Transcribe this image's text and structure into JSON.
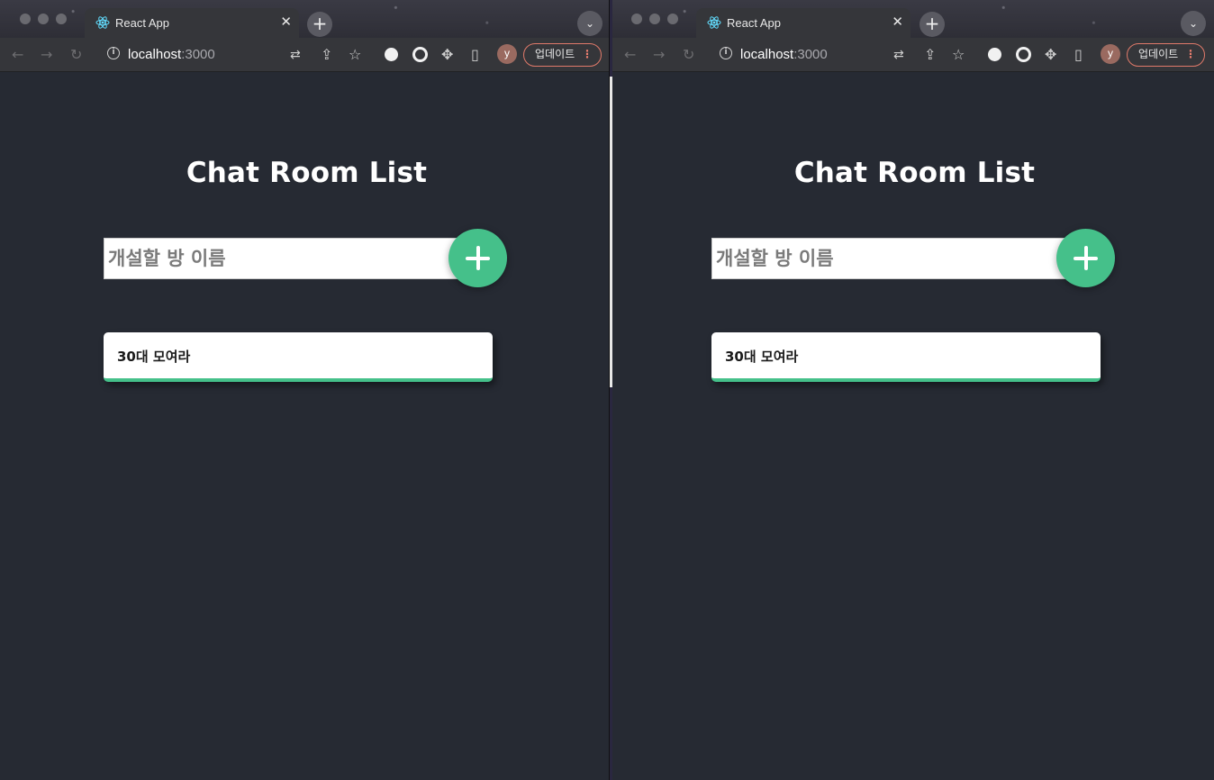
{
  "windows": [
    {
      "tab": {
        "title": "React App",
        "close": "✕"
      },
      "new_tab": "+",
      "url": {
        "host": "localhost",
        "port": ":3000"
      },
      "avatar": "y",
      "update_label": "업데이트",
      "app": {
        "title": "Chat Room List",
        "input_placeholder": "개설할 방 이름",
        "rooms": [
          {
            "name": "30대 모여라"
          }
        ]
      }
    },
    {
      "tab": {
        "title": "React App",
        "close": "✕"
      },
      "new_tab": "+",
      "url": {
        "host": "localhost",
        "port": ":3000"
      },
      "avatar": "y",
      "update_label": "업데이트",
      "app": {
        "title": "Chat Room List",
        "input_placeholder": "개설할 방 이름",
        "rooms": [
          {
            "name": "30대 모여라"
          }
        ]
      }
    }
  ],
  "colors": {
    "background": "#262a33",
    "accent": "#45c08a",
    "update_border": "#e07a6a"
  }
}
